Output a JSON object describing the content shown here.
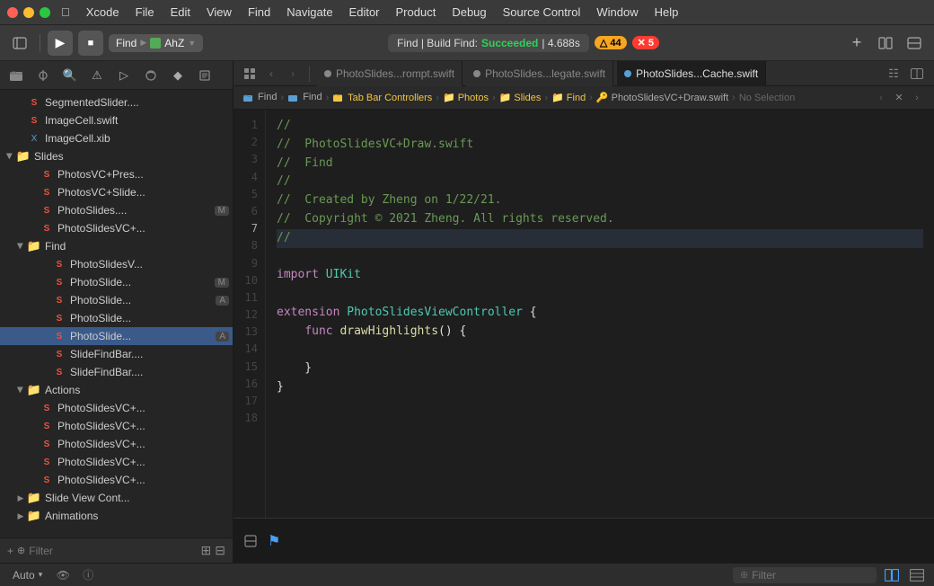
{
  "titleBar": {
    "appName": "Xcode",
    "menuItems": [
      "Apple",
      "Xcode",
      "File",
      "Edit",
      "View",
      "Find",
      "Navigate",
      "Editor",
      "Product",
      "Debug",
      "Source Control",
      "Window",
      "Help"
    ]
  },
  "toolbar": {
    "runLabel": "▶",
    "stopLabel": "■",
    "scheme": "Find",
    "target": "AhZ",
    "statusText": "Find | Build Find: ",
    "statusSuccess": "Succeeded",
    "statusTime": "| 4.688s",
    "warningCount": "44",
    "errorCount": "5"
  },
  "sidebarIcons": [
    "⬛",
    "📁",
    "🔍",
    "⚠",
    "⚙",
    "🔗",
    "◑",
    "⬡"
  ],
  "treeItems": [
    {
      "id": "segmented",
      "label": "SegmentedSlider....",
      "type": "swift",
      "indent": 1,
      "hasArrow": false,
      "selected": false
    },
    {
      "id": "imagecell-swift",
      "label": "ImageCell.swift",
      "type": "swift",
      "indent": 1,
      "hasArrow": false,
      "selected": false
    },
    {
      "id": "imagecell-xib",
      "label": "ImageCell.xib",
      "type": "xib",
      "indent": 1,
      "hasArrow": false,
      "selected": false
    },
    {
      "id": "slides-folder",
      "label": "Slides",
      "type": "folder",
      "indent": 0,
      "hasArrow": true,
      "open": true,
      "selected": false
    },
    {
      "id": "photosvc-pres",
      "label": "PhotosVC+Pres...",
      "type": "swift",
      "indent": 2,
      "hasArrow": false,
      "selected": false
    },
    {
      "id": "photosvc-slide",
      "label": "PhotosVC+Slide...",
      "type": "swift",
      "indent": 2,
      "hasArrow": false,
      "selected": false
    },
    {
      "id": "photoslides-m",
      "label": "PhotoSlides....",
      "type": "swift",
      "indent": 2,
      "hasArrow": false,
      "badge": "M",
      "selected": false
    },
    {
      "id": "photoslidesvc",
      "label": "PhotoSlidesVC+...",
      "type": "swift",
      "indent": 2,
      "hasArrow": false,
      "selected": false
    },
    {
      "id": "find-folder",
      "label": "Find",
      "type": "folder",
      "indent": 1,
      "hasArrow": true,
      "open": true,
      "selected": false
    },
    {
      "id": "photo-slides-v",
      "label": "PhotoSlidesV...",
      "type": "swift",
      "indent": 3,
      "hasArrow": false,
      "selected": false
    },
    {
      "id": "photoslide-m2",
      "label": "PhotoSlide...",
      "type": "swift",
      "indent": 3,
      "hasArrow": false,
      "badge": "M",
      "selected": false
    },
    {
      "id": "photoslide-a1",
      "label": "PhotoSlide...",
      "type": "swift",
      "indent": 3,
      "hasArrow": false,
      "badge": "A",
      "selected": false
    },
    {
      "id": "photoslide-2",
      "label": "PhotoSlide...",
      "type": "swift",
      "indent": 3,
      "hasArrow": false,
      "selected": false
    },
    {
      "id": "photoslide-a2",
      "label": "PhotoSlide...",
      "type": "swift",
      "indent": 3,
      "hasArrow": false,
      "badge": "A",
      "selected": true
    },
    {
      "id": "slidefindbar1",
      "label": "SlideFindBar....",
      "type": "swift",
      "indent": 3,
      "hasArrow": false,
      "selected": false
    },
    {
      "id": "slidefindbar2",
      "label": "SlideFindBar....",
      "type": "swift",
      "indent": 3,
      "hasArrow": false,
      "selected": false
    },
    {
      "id": "actions-folder",
      "label": "Actions",
      "type": "folder",
      "indent": 1,
      "hasArrow": true,
      "open": true,
      "selected": false
    },
    {
      "id": "photoslidesvc1",
      "label": "PhotoSlidesVC+...",
      "type": "swift",
      "indent": 2,
      "hasArrow": false,
      "selected": false
    },
    {
      "id": "photoslidesvc2",
      "label": "PhotoSlidesVC+...",
      "type": "swift",
      "indent": 2,
      "hasArrow": false,
      "selected": false
    },
    {
      "id": "photoslidesvc3",
      "label": "PhotoSlidesVC+...",
      "type": "swift",
      "indent": 2,
      "hasArrow": false,
      "selected": false
    },
    {
      "id": "photoslidesvc4",
      "label": "PhotoSlidesVC+...",
      "type": "swift",
      "indent": 2,
      "hasArrow": false,
      "selected": false
    },
    {
      "id": "photoslidesvc5",
      "label": "PhotoSlidesVC+...",
      "type": "swift",
      "indent": 2,
      "hasArrow": false,
      "selected": false
    },
    {
      "id": "slideviewcont",
      "label": "Slide View Cont...",
      "type": "folder",
      "indent": 1,
      "hasArrow": true,
      "open": false,
      "selected": false
    },
    {
      "id": "animations",
      "label": "Animations",
      "type": "folder",
      "indent": 1,
      "hasArrow": true,
      "open": false,
      "selected": false
    }
  ],
  "tabs": [
    {
      "id": "tab1",
      "label": "PhotoSlides...rompt.swift",
      "dotColor": "#888",
      "active": false
    },
    {
      "id": "tab2",
      "label": "PhotoSlides...legate.swift",
      "dotColor": "#888",
      "active": false
    },
    {
      "id": "tab3",
      "label": "PhotoSlides...Cache.swift",
      "dotColor": "#888",
      "active": true
    }
  ],
  "breadcrumb": {
    "items": [
      "Find",
      "Find",
      "Tab Bar Controllers",
      "Photos",
      "Slides",
      "Find",
      "PhotoSlidesVC+Draw.swift",
      "No Selection"
    ]
  },
  "codeLines": [
    {
      "num": 1,
      "text": "//",
      "class": "c-comment"
    },
    {
      "num": 2,
      "text": "//  PhotoSlidesVC+Draw.swift",
      "class": "c-comment"
    },
    {
      "num": 3,
      "text": "//  Find",
      "class": "c-comment"
    },
    {
      "num": 4,
      "text": "//",
      "class": "c-comment"
    },
    {
      "num": 5,
      "text": "//  Created by Zheng on 1/22/21.",
      "class": "c-comment"
    },
    {
      "num": 6,
      "text": "//  Copyright © 2021 Zheng. All rights reserved.",
      "class": "c-comment"
    },
    {
      "num": 7,
      "text": "//",
      "class": "c-comment",
      "highlight": true
    },
    {
      "num": 8,
      "text": ""
    },
    {
      "num": 9,
      "text": "import UIKit",
      "class": "mixed"
    },
    {
      "num": 10,
      "text": ""
    },
    {
      "num": 11,
      "text": "extension PhotoSlidesViewController {",
      "class": "mixed"
    },
    {
      "num": 12,
      "text": "    func drawHighlights() {",
      "class": "mixed"
    },
    {
      "num": 13,
      "text": ""
    },
    {
      "num": 14,
      "text": "    }",
      "class": "plain"
    },
    {
      "num": 15,
      "text": "}",
      "class": "plain"
    },
    {
      "num": 16,
      "text": ""
    },
    {
      "num": 17,
      "text": ""
    },
    {
      "num": 18,
      "text": ""
    }
  ],
  "statusBar": {
    "autoLabel": "Auto",
    "filterPlaceholder": "Filter"
  },
  "bottomBar": {
    "filterLabel": "Filter"
  }
}
